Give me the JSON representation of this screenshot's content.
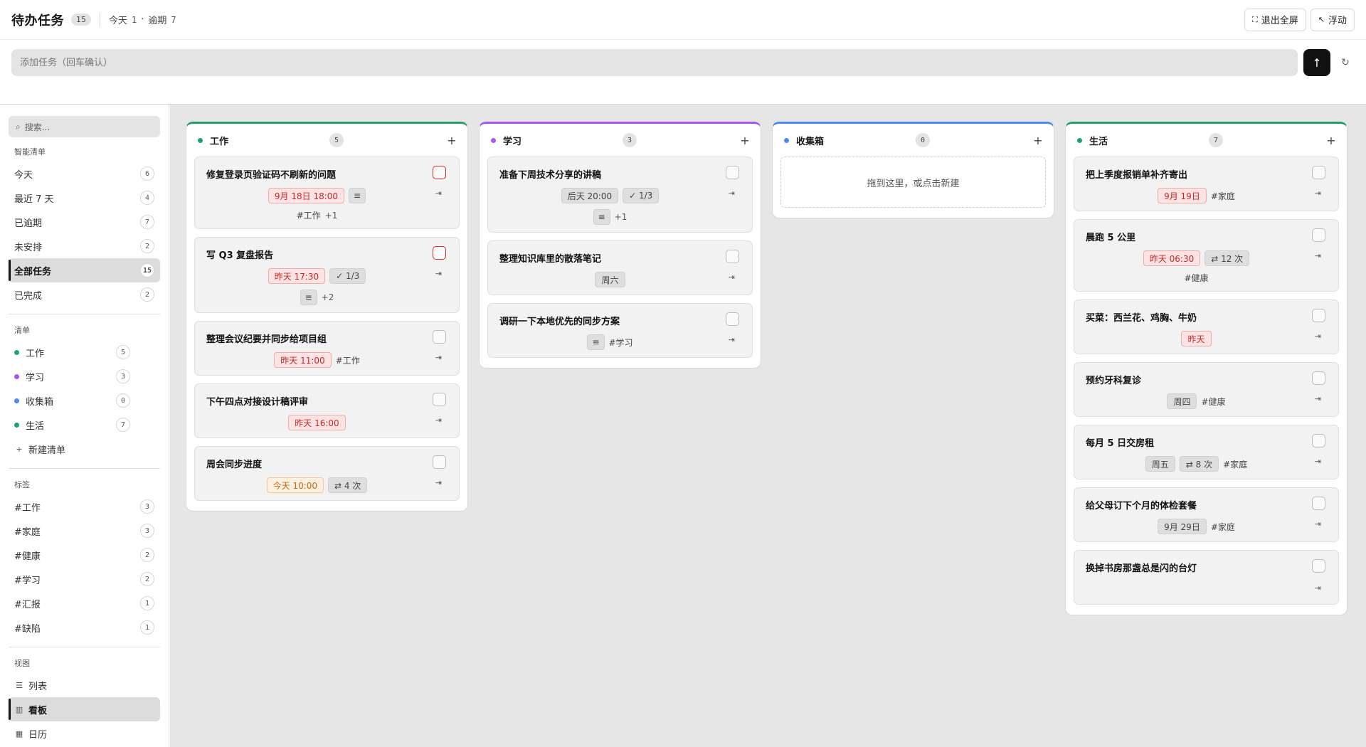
{
  "header": {
    "title": "待办任务",
    "total": "15",
    "today_label": "今天",
    "today_count": "1",
    "dot": "·",
    "overdue_label": "逾期",
    "overdue_count": "7",
    "exit_fullscreen": "退出全屏",
    "float": "浮动"
  },
  "add": {
    "placeholder": "添加任务（回车确认）"
  },
  "sidebar": {
    "search_placeholder": "搜索...",
    "smart_title": "智能清单",
    "smart": [
      {
        "label": "今天",
        "count": "6"
      },
      {
        "label": "最近 7 天",
        "count": "4"
      },
      {
        "label": "已逾期",
        "count": "7"
      },
      {
        "label": "未安排",
        "count": "2"
      },
      {
        "label": "全部任务",
        "count": "15"
      },
      {
        "label": "已完成",
        "count": "2"
      }
    ],
    "lists_title": "清单",
    "lists": [
      {
        "label": "工作",
        "count": "5",
        "color": "#22a06b"
      },
      {
        "label": "学习",
        "count": "3",
        "color": "#a855f7"
      },
      {
        "label": "收集箱",
        "count": "0",
        "color": "#4f86f7"
      },
      {
        "label": "生活",
        "count": "7",
        "color": "#22a06b"
      }
    ],
    "new_list": "新建清单",
    "tags_title": "标签",
    "tags": [
      {
        "label": "#工作",
        "count": "3"
      },
      {
        "label": "#家庭",
        "count": "3"
      },
      {
        "label": "#健康",
        "count": "2"
      },
      {
        "label": "#学习",
        "count": "2"
      },
      {
        "label": "#汇报",
        "count": "1"
      },
      {
        "label": "#缺陷",
        "count": "1"
      }
    ],
    "views_title": "视图",
    "views": [
      {
        "label": "列表"
      },
      {
        "label": "看板"
      },
      {
        "label": "日历"
      }
    ]
  },
  "board": {
    "columns": [
      {
        "name": "工作",
        "count": "5",
        "color": "#22a06b",
        "cards": [
          {
            "title": "修复登录页验证码不刷新的问题",
            "date": "9月 18日 18:00",
            "tag": "#工作",
            "more": "+1"
          },
          {
            "title": "写 Q3 复盘报告",
            "date": "昨天 17:30",
            "sub": "1/3",
            "more": "+2"
          },
          {
            "title": "整理会议纪要并同步给项目组",
            "date": "昨天 11:00",
            "tag": "#工作"
          },
          {
            "title": "下午四点对接设计稿评审",
            "date": "昨天 16:00"
          },
          {
            "title": "周会同步进度",
            "date": "今天 10:00",
            "repeat": "4 次"
          }
        ]
      },
      {
        "name": "学习",
        "count": "3",
        "color": "#a855f7",
        "cards": [
          {
            "title": "准备下周技术分享的讲稿",
            "date": "后天 20:00",
            "sub": "1/3",
            "more": "+1"
          },
          {
            "title": "整理知识库里的散落笔记",
            "date": "周六"
          },
          {
            "title": "调研一下本地优先的同步方案",
            "tag": "#学习"
          }
        ]
      },
      {
        "name": "收集箱",
        "count": "0",
        "color": "#4f86f7",
        "empty": "拖到这里，或点击新建"
      },
      {
        "name": "生活",
        "count": "7",
        "color": "#22a06b",
        "cards": [
          {
            "title": "把上季度报销单补齐寄出",
            "date": "9月 19日",
            "tag": "#家庭"
          },
          {
            "title": "晨跑 5 公里",
            "date": "昨天 06:30",
            "repeat": "12 次",
            "tag": "#健康"
          },
          {
            "title": "买菜：西兰花、鸡胸、牛奶",
            "date": "昨天"
          },
          {
            "title": "预约牙科复诊",
            "date": "周四",
            "tag": "#健康"
          },
          {
            "title": "每月 5 日交房租",
            "date": "周五",
            "repeat": "8 次",
            "tag": "#家庭"
          },
          {
            "title": "给父母订下个月的体检套餐",
            "date": "9月 29日",
            "tag": "#家庭"
          },
          {
            "title": "换掉书房那盏总是闪的台灯"
          }
        ]
      }
    ]
  }
}
